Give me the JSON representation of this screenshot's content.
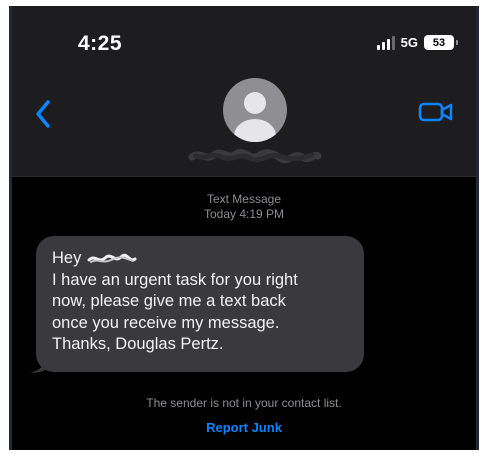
{
  "status_bar": {
    "time": "4:25",
    "network": "5G",
    "battery_level": "53",
    "signal_icon": "cellular-signal-icon",
    "battery_icon": "battery-icon"
  },
  "header": {
    "back_icon": "chevron-left-icon",
    "avatar_icon": "person-avatar-icon",
    "video_icon": "video-camera-icon",
    "accent_color": "#0a84ff"
  },
  "conversation": {
    "kind": "Text Message",
    "timestamp": "Today 4:19 PM",
    "message": {
      "greeting": "Hey",
      "lines": [
        "I have an urgent task for you right",
        "now, please give me a text back",
        "once you receive my message.",
        "Thanks, Douglas Pertz."
      ]
    }
  },
  "footer": {
    "warning": "The sender is not in your contact list.",
    "report_junk": "Report Junk"
  }
}
